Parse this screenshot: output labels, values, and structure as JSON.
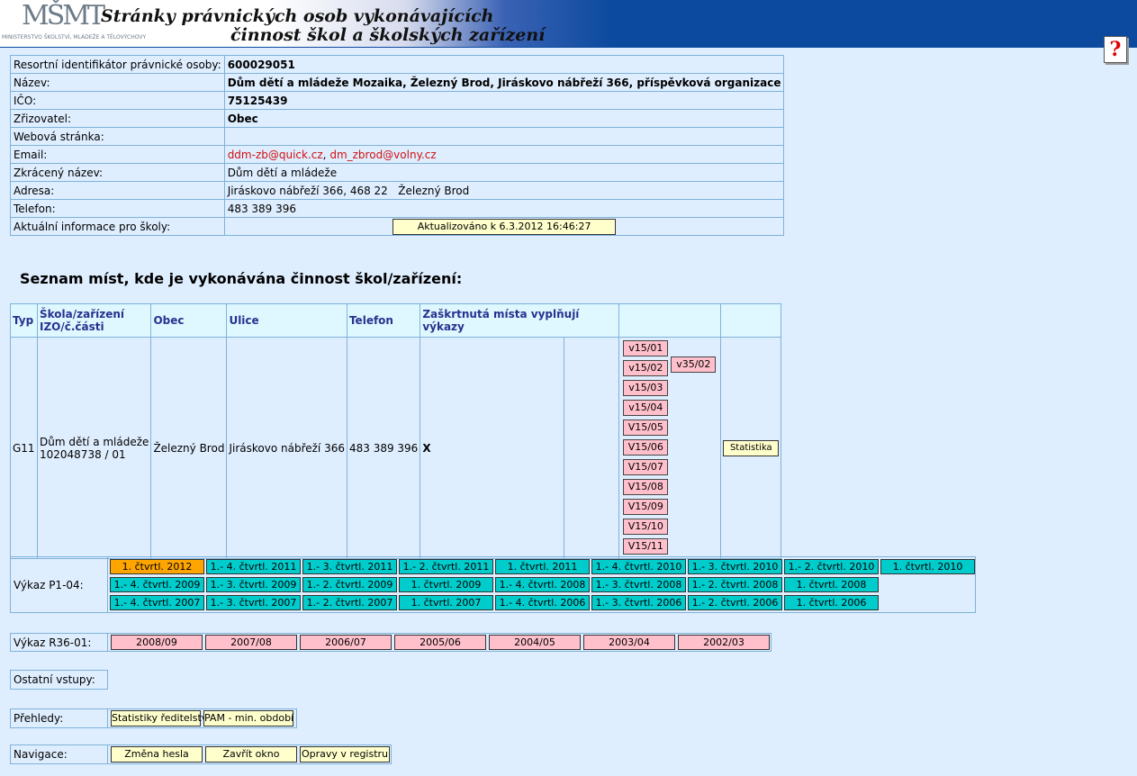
{
  "header": {
    "logo_mark": "MŠMT",
    "logo_sub": "MINISTERSTVO ŠKOLSTVÍ, MLÁDEŽE A TĚLOVÝCHOVY",
    "title_line1": "Stránky právnických osob vykonávajících",
    "title_line2": "činnost škol a školských zařízení",
    "help_glyph": "?"
  },
  "info": {
    "rid_label": "Resortní identifikátor právnické osoby:",
    "rid_value": "600029051",
    "name_label": "Název:",
    "name_value": "Dům dětí a mládeže Mozaika, Železný Brod, Jiráskovo nábřeží 366, příspěvková organizace",
    "ico_label": "IČO:",
    "ico_value": "75125439",
    "zrizovatel_label": "Zřizovatel:",
    "zrizovatel_value": "Obec",
    "web_label": "Webová stránka:",
    "web_value": "",
    "email_label": "Email:",
    "email_1": "ddm-zb@quick.cz",
    "email_sep": ",",
    "email_2": "dm_zbrod@volny.cz",
    "short_label": "Zkrácený název:",
    "short_value": "Dům dětí a mládeže",
    "address_label": "Adresa:",
    "address_value": "Jiráskovo nábřeží 366, 468 22   Železný Brod",
    "phone_label": "Telefon:",
    "phone_value": "483 389 396",
    "news_label": "Aktuální informace pro školy:",
    "news_button": "Aktualizováno k 6.3.2012 16:46:27"
  },
  "places": {
    "heading": "Seznam míst, kde je vykonávána činnost škol/zařízení:",
    "headers": {
      "typ": "Typ",
      "skola_l1": "Škola/zařízení",
      "skola_l2": "IZO/č.části",
      "obec": "Obec",
      "ulice": "Ulice",
      "telefon": "Telefon",
      "vykazy": "Zaškrtnutá místa vyplňují výkazy"
    },
    "row": {
      "typ": "G11",
      "skola": "Dům dětí a mládeže",
      "izo": "102048738 / 01",
      "obec": "Železný Brod",
      "ulice": "Jiráskovo nábřeží 366",
      "telefon": "483 389 396",
      "mark": "X",
      "vykazy": [
        "v15/01",
        "v15/02",
        "v15/03",
        "v15/04",
        "V15/05",
        "V15/06",
        "V15/07",
        "V15/08",
        "V15/09",
        "V15/10",
        "V15/11"
      ],
      "vykaz_extra": "v35/02",
      "stat_button": "Statistika"
    }
  },
  "p104": {
    "label": "Výkaz P1-04:",
    "row1": [
      "1. čtvrtl. 2012",
      "1.- 4. čtvrtl. 2011",
      "1.- 3. čtvrtl. 2011",
      "1.- 2. čtvrtl. 2011",
      "1. čtvrtl. 2011",
      "1.- 4. čtvrtl. 2010",
      "1.- 3. čtvrtl. 2010",
      "1.- 2. čtvrtl. 2010",
      "1. čtvrtl. 2010"
    ],
    "row2": [
      "1.- 4. čtvrtl. 2009",
      "1.- 3. čtvrtl. 2009",
      "1.- 2. čtvrtl. 2009",
      "1. čtvrtl. 2009",
      "1.- 4. čtvrtl. 2008",
      "1.- 3. čtvrtl. 2008",
      "1.- 2. čtvrtl. 2008",
      "1. čtvrtl. 2008"
    ],
    "row3": [
      "1.- 4. čtvrtl. 2007",
      "1.- 3. čtvrtl. 2007",
      "1.- 2. čtvrtl. 2007",
      "1. čtvrtl. 2007",
      "1.- 4. čtvrtl. 2006",
      "1.- 3. čtvrtl. 2006",
      "1.- 2. čtvrtl. 2006",
      "1. čtvrtl. 2006"
    ]
  },
  "r36": {
    "label": "Výkaz R36-01:",
    "years": [
      "2008/09",
      "2007/08",
      "2006/07",
      "2005/06",
      "2004/05",
      "2003/04",
      "2002/03"
    ]
  },
  "ostatni": {
    "label": "Ostatní vstupy:"
  },
  "prehledy": {
    "label": "Přehledy:",
    "btn_stats": "Statistiky ředitelství",
    "btn_pam": "PAM - min. období"
  },
  "navigace": {
    "label": "Navigace:",
    "btn_heslo": "Změna hesla",
    "btn_zavrit": "Zavřít okno",
    "btn_opravy": "Opravy v registru"
  },
  "colors": {
    "page_bg": "#dfeeff",
    "header_blue": "#0b4a9e",
    "border": "#7fb2d8",
    "teal_button": "#00cccc",
    "orange_active": "#ffa500",
    "pink_button": "#ffc0cb",
    "yellow_button": "#ffffcc",
    "link_red": "#d01010",
    "table_head_text": "#26328f"
  }
}
